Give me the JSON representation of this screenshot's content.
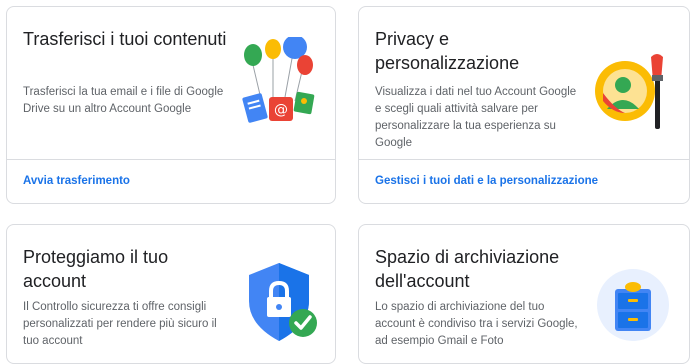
{
  "cards": [
    {
      "title": "Trasferisci i tuoi contenuti",
      "description": "Trasferisci la tua email e i file di Google Drive su un altro Account Google",
      "link": "Avvia trasferimento",
      "icon": "transfer-balloons-illustration"
    },
    {
      "title": "Privacy e personalizzazione",
      "description": "Visualizza i dati nel tuo Account Google e scegli quali attività salvare per personalizzare la tua esperienza su Google",
      "link": "Gestisci i tuoi dati e la personalizzazione",
      "icon": "privacy-paintbrush-illustration"
    },
    {
      "title": "Proteggiamo il tuo account",
      "description": "Il Controllo sicurezza ti offre consigli personalizzati per rendere più sicuro il tuo account",
      "icon": "security-shield-illustration"
    },
    {
      "title": "Spazio di archiviazione dell'account",
      "description": "Lo spazio di archiviazione del tuo account è condiviso tra i servizi Google, ad esempio Gmail e Foto",
      "icon": "storage-cabinet-illustration"
    }
  ],
  "colors": {
    "link": "#1a73e8",
    "title": "#202124",
    "body": "#5f6368",
    "border": "#dadce0"
  }
}
